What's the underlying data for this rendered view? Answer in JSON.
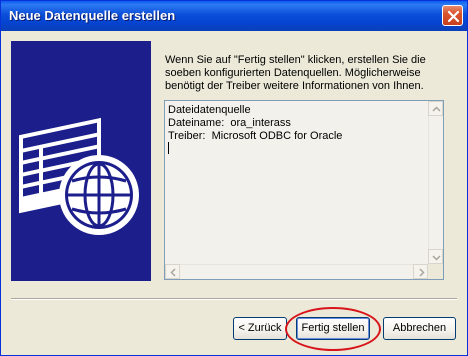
{
  "window": {
    "title": "Neue Datenquelle erstellen"
  },
  "info": {
    "text": "Wenn Sie auf \"Fertig stellen\" klicken, erstellen Sie die soeben konfigurierten Datenquellen. Möglicherweise benötigt der Treiber weitere Informationen von Ihnen."
  },
  "summary": {
    "lines": [
      "Dateidatenquelle",
      "Dateiname:  ora_interass",
      "Treiber:  Microsoft ODBC for Oracle"
    ]
  },
  "buttons": {
    "back": "< Zurück",
    "finish": "Fertig stellen",
    "cancel": "Abbrechen"
  },
  "icons": {
    "close": "close-icon",
    "wizard": "database-globe-icon",
    "scroll_up": "arrow-up-icon",
    "scroll_down": "arrow-down-icon",
    "scroll_left": "arrow-left-icon",
    "scroll_right": "arrow-right-icon"
  },
  "colors": {
    "title_bar": "#0A5BEF",
    "illustration_bg": "#1C1E8C",
    "highlight_circle": "#D8141A"
  }
}
